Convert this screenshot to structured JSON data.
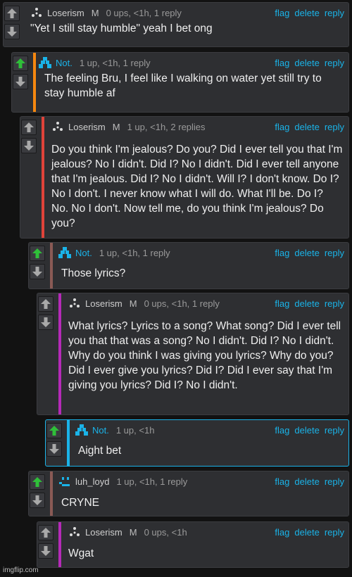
{
  "actions": {
    "flag": "flag",
    "delete": "delete",
    "reply": "reply"
  },
  "comments": [
    {
      "username": "Loserism",
      "mod_flag": "M",
      "meta": "0 ups, <1h, 1 reply",
      "text": "\"Yet I still stay humble\" yeah I bet ong",
      "avatar": "triangle-dots-avatar",
      "upvoted": false,
      "bar_color": ""
    },
    {
      "username": "Not.",
      "mod_flag": "",
      "meta": "1 up, <1h, 1 reply",
      "text": "The feeling Bru, I feel like I walking on water yet still try to stay humble af",
      "avatar": "blue-blocks-avatar",
      "upvoted": true,
      "bar_color": "#f5870f"
    },
    {
      "username": "Loserism",
      "mod_flag": "M",
      "meta": "1 up, <1h, 2 replies",
      "text": "Do you think I'm jealous? Do you? Did I ever tell you that I'm jealous? No I didn't. Did I? No I didn't. Did I ever tell anyone that I'm jealous. Did I? No I didn't. Will I? I don't know. Do I? No I don't. I never know what I will do. What I'll be. Do I? No. No I don't. Now tell me, do you think I'm jealous? Do you?",
      "avatar": "triangle-dots-avatar",
      "upvoted": false,
      "bar_color": "#e0433a"
    },
    {
      "username": "Not.",
      "mod_flag": "",
      "meta": "1 up, <1h, 1 reply",
      "text": "Those lyrics?",
      "avatar": "blue-blocks-avatar",
      "upvoted": true,
      "bar_color": "#8a5a55"
    },
    {
      "username": "Loserism",
      "mod_flag": "M",
      "meta": "0 ups, <1h, 1 reply",
      "text": "What lyrics? Lyrics to a song? What song? Did I ever tell you that that was a song? No I didn't. Did I? No I didn't. Why do you think I was giving you lyrics? Why do you? Did I ever give you lyrics? Did I? Did I ever say that I'm giving you lyrics? Did I? No I didn't.",
      "avatar": "triangle-dots-avatar",
      "upvoted": false,
      "bar_color": "#b52ab8"
    },
    {
      "username": "Not.",
      "mod_flag": "",
      "meta": "1 up, <1h",
      "text": "Aight bet",
      "avatar": "blue-blocks-avatar",
      "upvoted": true,
      "bar_color": "#1ab3e8"
    },
    {
      "username": "luh_loyd",
      "mod_flag": "",
      "meta": "1 up, <1h, 1 reply",
      "text": "CRYNE",
      "avatar": "face-avatar",
      "upvoted": true,
      "bar_color": "#8a5a55"
    },
    {
      "username": "Loserism",
      "mod_flag": "M",
      "meta": "0 ups, <1h",
      "text": "Wgat",
      "avatar": "triangle-dots-avatar",
      "upvoted": false,
      "bar_color": "#b52ab8"
    }
  ],
  "watermark": "imgflip.com"
}
